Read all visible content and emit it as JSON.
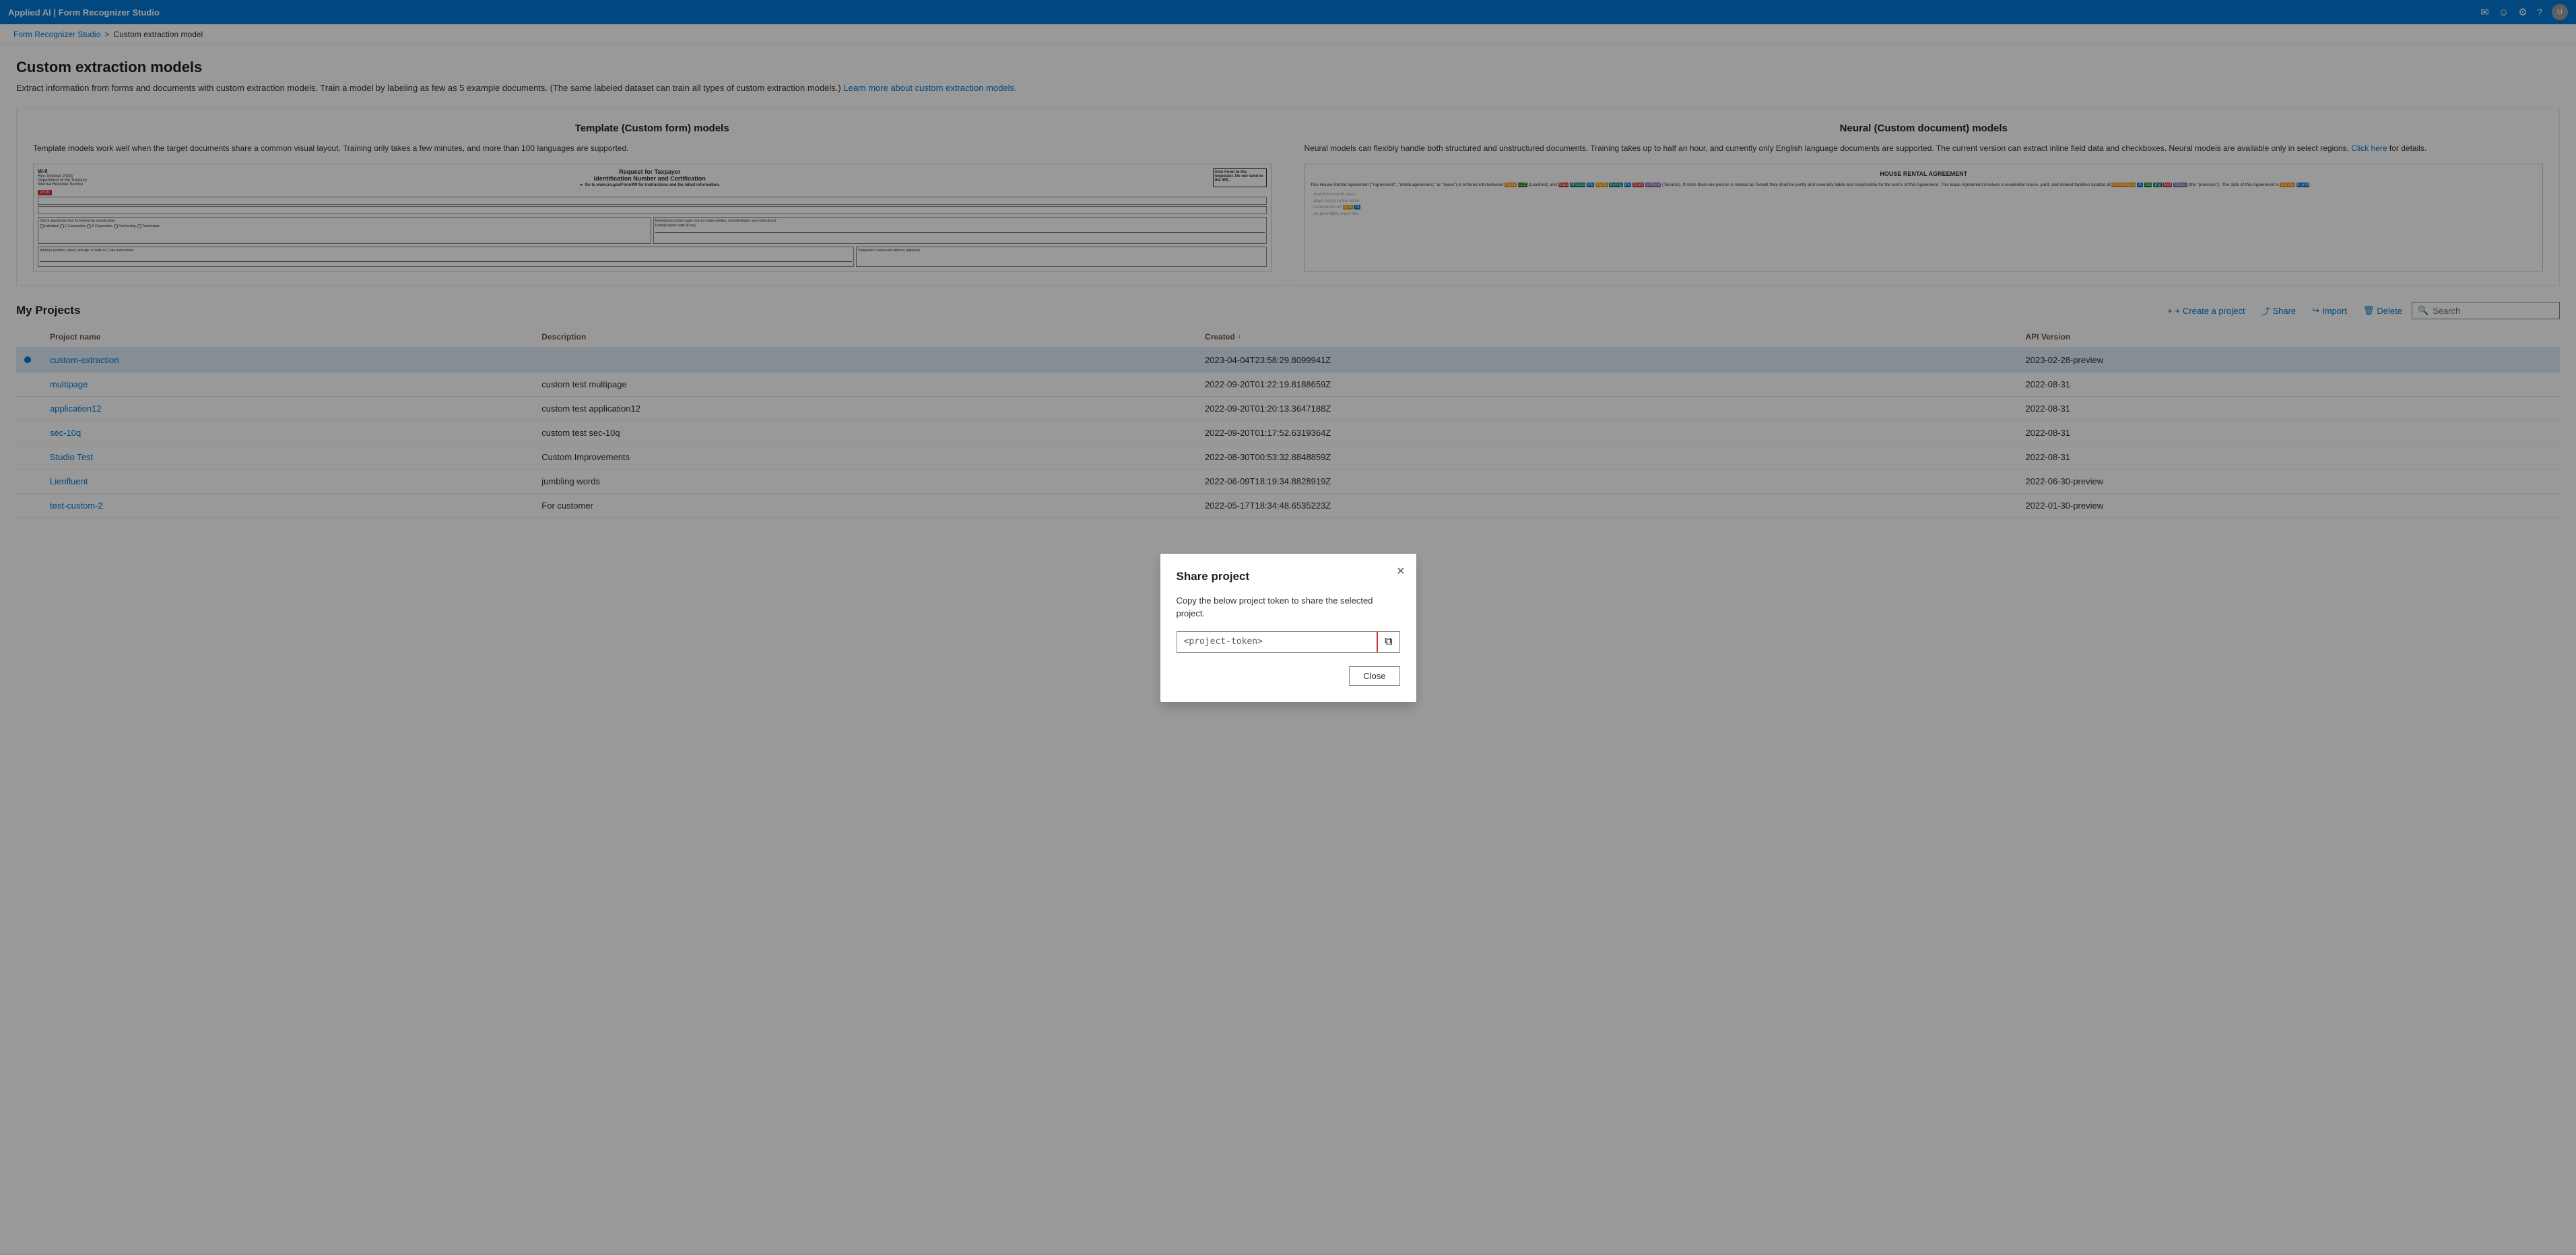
{
  "app": {
    "title": "Applied AI | Form Recognizer Studio"
  },
  "topbar": {
    "title": "Applied AI | Form Recognizer Studio",
    "icons": [
      "email-icon",
      "smiley-icon",
      "gear-icon",
      "help-icon"
    ],
    "avatar_label": "U"
  },
  "breadcrumb": {
    "home": "Form Recognizer Studio",
    "separator": ">",
    "current": "Custom extraction model"
  },
  "page": {
    "title": "Custom extraction models",
    "description": "Extract information from forms and documents with custom extraction models. Train a model by labeling as few as 5 example documents. (The same labeled dataset can train all types of custom extraction models.)",
    "learn_more_text": "Learn more about custom extraction models.",
    "learn_more_url": "#"
  },
  "template_model": {
    "title": "Template (Custom form) models",
    "description": "Template models work well when the target documents share a common visual layout. Training only takes a few minutes, and more than 100 languages are supported."
  },
  "neural_model": {
    "title": "Neural (Custom document) models",
    "description": "Neural models can flexibly handle both structured and unstructured documents. Training takes up to half an hour, and currently only English language documents are supported. The current version can extract inline field data and checkboxes. Neural models are available only in select regions.",
    "click_here_text": "Click here",
    "details_suffix": " for details."
  },
  "projects_section": {
    "title": "My Projects",
    "actions": {
      "create": "+ Create a project",
      "share": "Share",
      "import": "Import",
      "delete": "Delete"
    },
    "search_placeholder": "Search"
  },
  "table": {
    "columns": [
      "",
      "Project name",
      "Description",
      "Created ↓",
      "API Version"
    ],
    "rows": [
      {
        "selected": true,
        "indicator": true,
        "name": "custom-extraction",
        "description": "",
        "created": "2023-04-04T23:58:29.8099941Z",
        "api_version": "2023-02-28-preview"
      },
      {
        "selected": false,
        "indicator": false,
        "name": "multipage",
        "description": "custom test multipage",
        "created": "2022-09-20T01:22:19.8188659Z",
        "api_version": "2022-08-31"
      },
      {
        "selected": false,
        "indicator": false,
        "name": "application12",
        "description": "custom test application12",
        "created": "2022-09-20T01:20:13.3647188Z",
        "api_version": "2022-08-31"
      },
      {
        "selected": false,
        "indicator": false,
        "name": "sec-10q",
        "description": "custom test sec-10q",
        "created": "2022-09-20T01:17:52.6319364Z",
        "api_version": "2022-08-31"
      },
      {
        "selected": false,
        "indicator": false,
        "name": "Studio Test",
        "description": "Custom Improvements",
        "created": "2022-08-30T00:53:32.8848859Z",
        "api_version": "2022-08-31"
      },
      {
        "selected": false,
        "indicator": false,
        "name": "Lienfluent",
        "description": "jumbling words",
        "created": "2022-06-09T18:19:34.8828919Z",
        "api_version": "2022-06-30-preview"
      },
      {
        "selected": false,
        "indicator": false,
        "name": "test-custom-2",
        "description": "For customer",
        "created": "2022-05-17T18:34:48.6535223Z",
        "api_version": "2022-01-30-preview"
      }
    ]
  },
  "modal": {
    "title": "Share project",
    "description": "Copy the below project token to share the selected project.",
    "token_placeholder": "<project-token>",
    "close_label": "Close"
  },
  "icons": {
    "email": "✉",
    "smiley": "☺",
    "gear": "⚙",
    "help": "?",
    "search": "🔍",
    "copy": "⧉",
    "close": "✕",
    "create_plus": "+",
    "share": "↑",
    "import": "↪",
    "delete": "🗑"
  }
}
